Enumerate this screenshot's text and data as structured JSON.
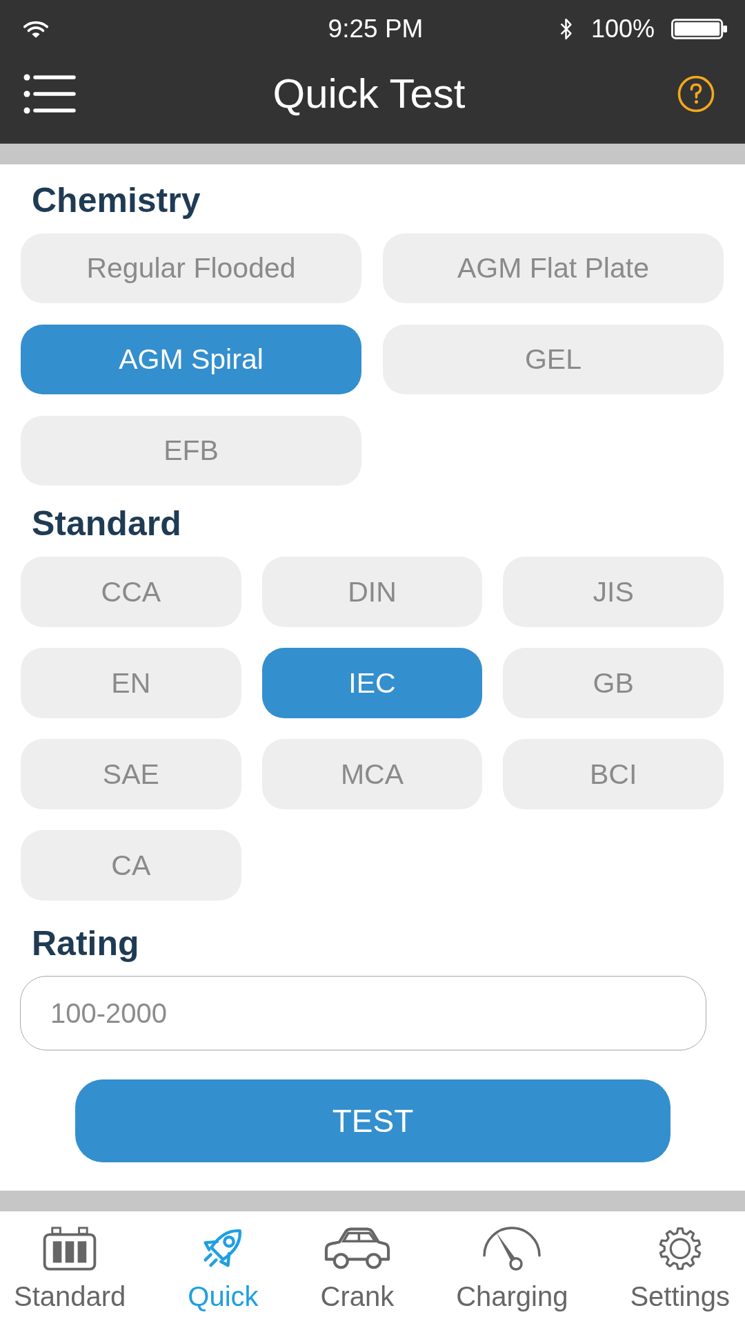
{
  "status_bar": {
    "time": "9:25 PM",
    "battery": "100%"
  },
  "header": {
    "title": "Quick Test"
  },
  "chemistry": {
    "heading": "Chemistry",
    "options": [
      {
        "label": "Regular Flooded",
        "selected": false
      },
      {
        "label": "AGM Flat Plate",
        "selected": false
      },
      {
        "label": "AGM Spiral",
        "selected": true
      },
      {
        "label": "GEL",
        "selected": false
      },
      {
        "label": "EFB",
        "selected": false
      }
    ]
  },
  "standard": {
    "heading": "Standard",
    "options": [
      {
        "label": "CCA",
        "selected": false
      },
      {
        "label": "DIN",
        "selected": false
      },
      {
        "label": "JIS",
        "selected": false
      },
      {
        "label": "EN",
        "selected": false
      },
      {
        "label": "IEC",
        "selected": true
      },
      {
        "label": "GB",
        "selected": false
      },
      {
        "label": "SAE",
        "selected": false
      },
      {
        "label": "MCA",
        "selected": false
      },
      {
        "label": "BCI",
        "selected": false
      },
      {
        "label": "CA",
        "selected": false
      }
    ]
  },
  "rating": {
    "heading": "Rating",
    "placeholder": "100-2000"
  },
  "test_button": {
    "label": "TEST"
  },
  "bottom_nav": [
    {
      "label": "Standard",
      "selected": false
    },
    {
      "label": "Quick",
      "selected": true
    },
    {
      "label": "Crank",
      "selected": false
    },
    {
      "label": "Charging",
      "selected": false
    },
    {
      "label": "Settings",
      "selected": false
    }
  ]
}
